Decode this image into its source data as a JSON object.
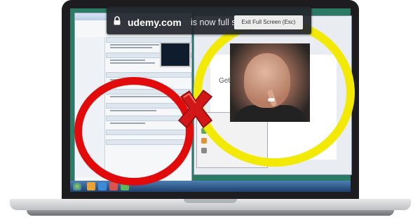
{
  "fullscreen_bar": {
    "domain": "udemy.com",
    "message": "is now full screen",
    "exit_label": "Exit Full Screen (Esc)"
  },
  "right_window": {
    "heading": "Getting"
  },
  "colors": {
    "bar_bg": "#22262c",
    "red_circle": "#e10b0b",
    "yellow_circle": "#f2ea06",
    "cross": "#d11717",
    "taskbar": "#2b5b92"
  },
  "icons": [
    "lock-icon",
    "cross-icon",
    "windows-start-icon"
  ]
}
